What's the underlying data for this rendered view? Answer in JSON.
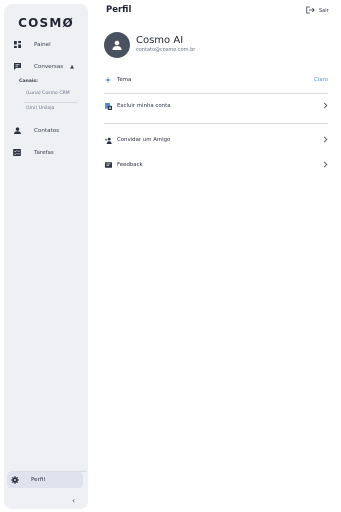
{
  "sidebar": {
    "logo": "COSMØ",
    "items": {
      "painel": {
        "label": "Painel",
        "icon": "dashboard-icon"
      },
      "conversas": {
        "label": "Conversas",
        "icon": "chat-icon"
      },
      "contatos": {
        "label": "Contatos",
        "icon": "person-icon"
      },
      "tarefas": {
        "label": "Tarefas",
        "icon": "tasks-icon"
      }
    },
    "canais_label": "Canais:",
    "channels": [
      "(Luna) Cosmo CRM",
      "(Uni) Unilaja"
    ],
    "perfil": {
      "label": "Perfil",
      "icon": "gear-icon"
    }
  },
  "header": {
    "title": "Perfil",
    "logout_label": "Sair"
  },
  "profile": {
    "name": "Cosmo AI",
    "email": "contato@cosmo.com.br"
  },
  "settings": {
    "tema": {
      "label": "Tema",
      "value": "Claro"
    },
    "excluir": {
      "label": "Excluir minha conta"
    },
    "convidar": {
      "label": "Convidar um Amigo"
    },
    "feedback": {
      "label": "Feedback"
    }
  },
  "colors": {
    "accent": "#4f8fd6",
    "sidebar_bg": "#eef0f4",
    "active_bg": "#dfe3ee",
    "avatar_bg": "#4a5160"
  }
}
